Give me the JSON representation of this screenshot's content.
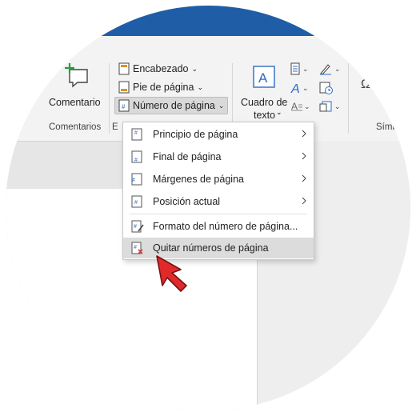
{
  "ribbon": {
    "comment_label": "Comentario",
    "comments_group": "Comentarios",
    "header_label": "Encabezado",
    "footer_label": "Pie de página",
    "page_number_label": "Número de página",
    "group_cut": "E",
    "textbox_label_line1": "Cuadro de",
    "textbox_label_line2": "texto",
    "symbols_cut": "Símb",
    "symbol_glyph": "Ω"
  },
  "menu": {
    "items": [
      {
        "label": "Principio de página",
        "has_submenu": true,
        "icon": "page-top-number-icon"
      },
      {
        "label": "Final de página",
        "has_submenu": true,
        "icon": "page-bottom-number-icon"
      },
      {
        "label": "Márgenes de página",
        "has_submenu": true,
        "icon": "page-margin-number-icon"
      },
      {
        "label": "Posición actual",
        "has_submenu": true,
        "icon": "page-current-number-icon"
      },
      {
        "label": "Formato del número de página...",
        "has_submenu": false,
        "icon": "format-page-number-icon"
      },
      {
        "label": "Quitar números de página",
        "has_submenu": false,
        "icon": "remove-page-number-icon",
        "highlighted": true
      }
    ]
  },
  "colors": {
    "title_bar": "#1f5ea6",
    "ribbon": "#f3f3f3",
    "highlight": "#dcdcdc",
    "accent_green": "#2a9d3f",
    "accent_blue": "#2b6cc4",
    "cursor_red": "#e02a2a"
  }
}
